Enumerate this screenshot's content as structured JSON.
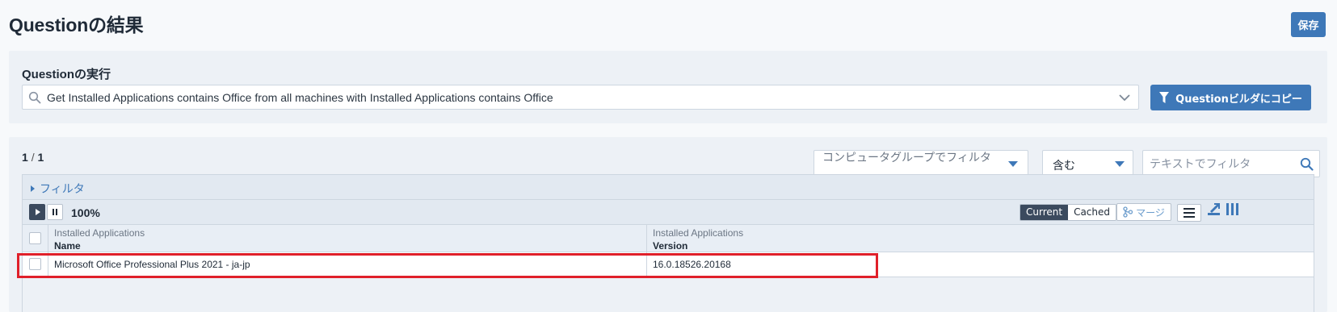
{
  "page": {
    "title": "Questionの結果",
    "save_label": "保存"
  },
  "run": {
    "title": "Questionの実行",
    "query": "Get Installed Applications contains Office from all machines with Installed Applications contains Office",
    "copy_button": "Questionビルダにコピー"
  },
  "results": {
    "pager": {
      "current": "1",
      "separator": "/",
      "total": "1"
    },
    "group_filter_placeholder": "コンピュータグループでフィルタ",
    "match_mode": "含む",
    "text_filter_placeholder": "テキストでフィルタ",
    "filter_toggle": "フィルタ",
    "progress": "100%",
    "view_toggle": {
      "current": "Current",
      "cached": "Cached",
      "active": "Current"
    },
    "merge_label": "マージ",
    "columns": [
      {
        "sensor": "Installed Applications",
        "name": "Name"
      },
      {
        "sensor": "Installed Applications",
        "name": "Version"
      }
    ],
    "rows": [
      {
        "name": "Microsoft Office Professional Plus 2021 - ja-jp",
        "version": "16.0.18526.20168"
      }
    ]
  },
  "colors": {
    "accent": "#3e78b8",
    "highlight": "#e0202a",
    "dark": "#3b4a5e"
  }
}
